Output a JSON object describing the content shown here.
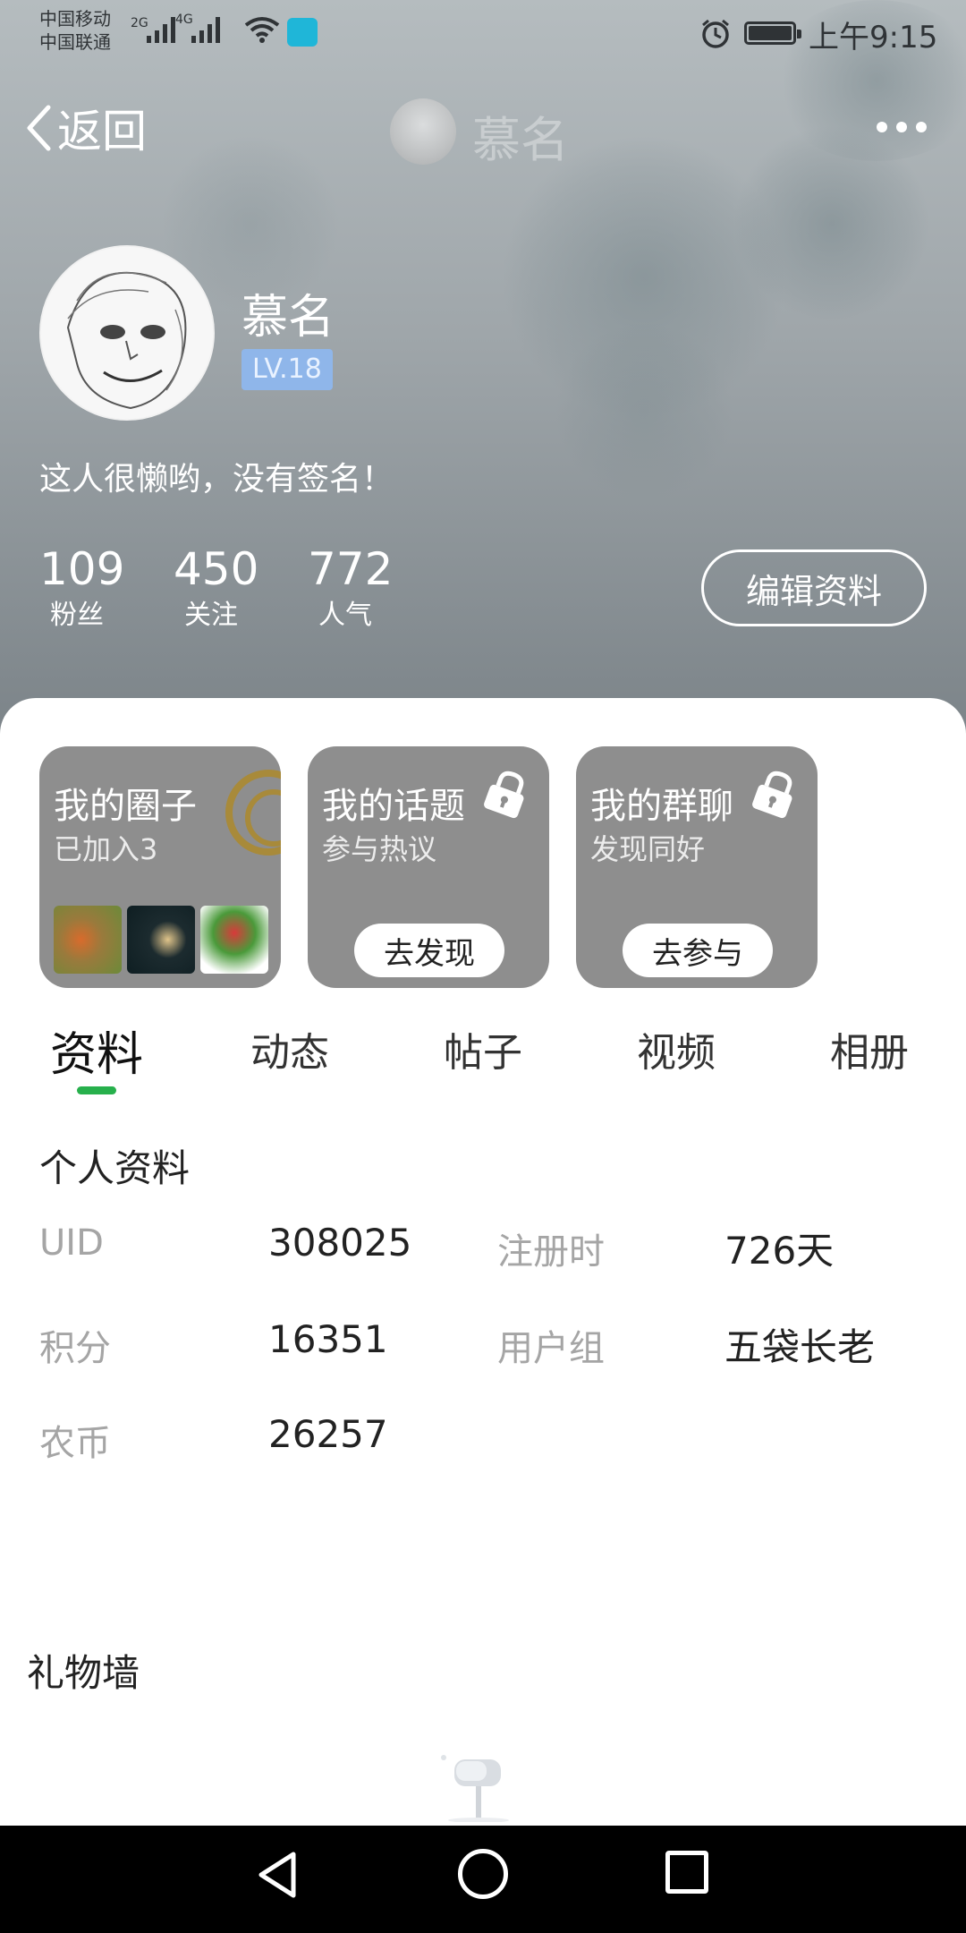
{
  "status_bar": {
    "carrier_1": "中国移动",
    "carrier_2": "中国联通",
    "net_1": "2G",
    "net_2": "4G",
    "time": "上午9:15"
  },
  "nav": {
    "back_label": "返回",
    "title": "慕名"
  },
  "profile": {
    "name": "慕名",
    "level": "LV.18",
    "signature": "这人很懒哟，没有签名！",
    "stats": [
      {
        "value": "109",
        "label": "粉丝"
      },
      {
        "value": "450",
        "label": "关注"
      },
      {
        "value": "772",
        "label": "人气"
      }
    ],
    "edit_label": "编辑资料"
  },
  "cards": {
    "circle": {
      "title": "我的圈子",
      "subtitle": "已加入3"
    },
    "topic": {
      "title": "我的话题",
      "subtitle": "参与热议",
      "button": "去发现"
    },
    "group": {
      "title": "我的群聊",
      "subtitle": "发现同好",
      "button": "去参与"
    }
  },
  "tabs": [
    "资料",
    "动态",
    "帖子",
    "视频",
    "相册"
  ],
  "info": {
    "title": "个人资料",
    "uid_label": "UID",
    "uid_value": "308025",
    "reg_label": "注册时",
    "reg_value": "726天",
    "points_label": "积分",
    "points_value": "16351",
    "group_label": "用户组",
    "group_value": "五袋长老",
    "coin_label": "农币",
    "coin_value": "26257"
  },
  "gift_wall": {
    "title": "礼物墙"
  },
  "colors": {
    "accent": "#27b04c",
    "level_badge": "#8fb6ea",
    "card_bg": "#8e8e8e"
  }
}
